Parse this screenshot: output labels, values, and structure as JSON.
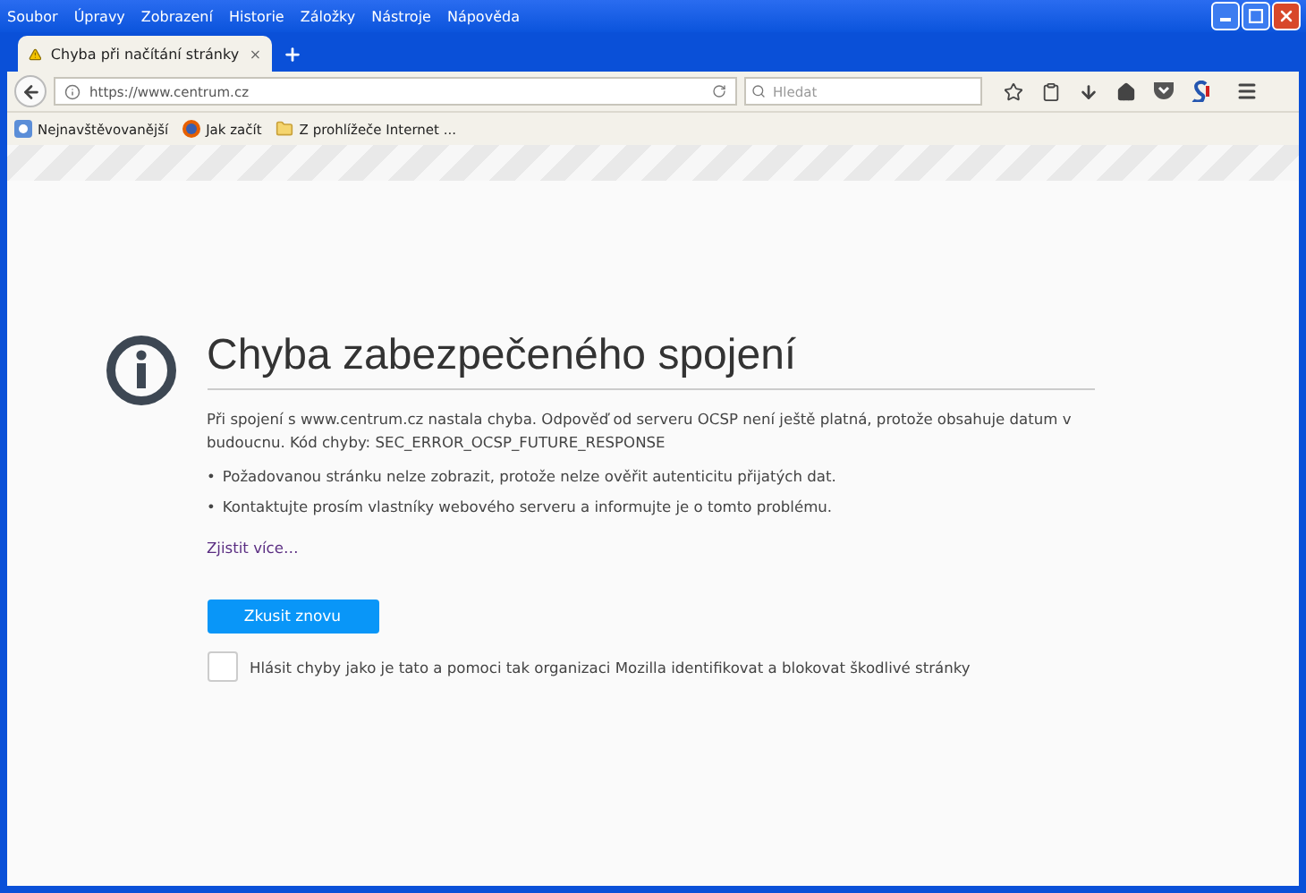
{
  "menu": [
    "Soubor",
    "Úpravy",
    "Zobrazení",
    "Historie",
    "Záložky",
    "Nástroje",
    "Nápověda"
  ],
  "tabs": [
    {
      "title": "Chyba při načítání stránky",
      "selected": true
    }
  ],
  "address": {
    "value": "https://www.centrum.cz"
  },
  "search": {
    "placeholder": "Hledat"
  },
  "bookmarks": [
    "Nejnavštěvovanější",
    "Jak začít",
    "Z prohlížeče Internet ..."
  ],
  "error": {
    "title": "Chyba zabezpečeného spojení",
    "message": "Při spojení s www.centrum.cz nastala chyba. Odpověď od serveru OCSP není ještě platná, protože obsahuje datum v budoucnu. Kód chyby: SEC_ERROR_OCSP_FUTURE_RESPONSE",
    "bullets": [
      {
        "marker": "•",
        "text": "Požadovanou stránku nelze zobrazit, protože nelze ověřit autenticitu přijatých dat."
      },
      {
        "marker": "•",
        "text": "Kontaktujte prosím vlastníky webového serveru a informujte je o tomto problému."
      }
    ],
    "link": "Zjistit více…",
    "button": "Zkusit znovu",
    "report": {
      "label": "Hlásit chyby jako je tato a pomoci tak organizaci Mozilla identifikovat a blokovat škodlivé stránky",
      "checked": false
    }
  }
}
